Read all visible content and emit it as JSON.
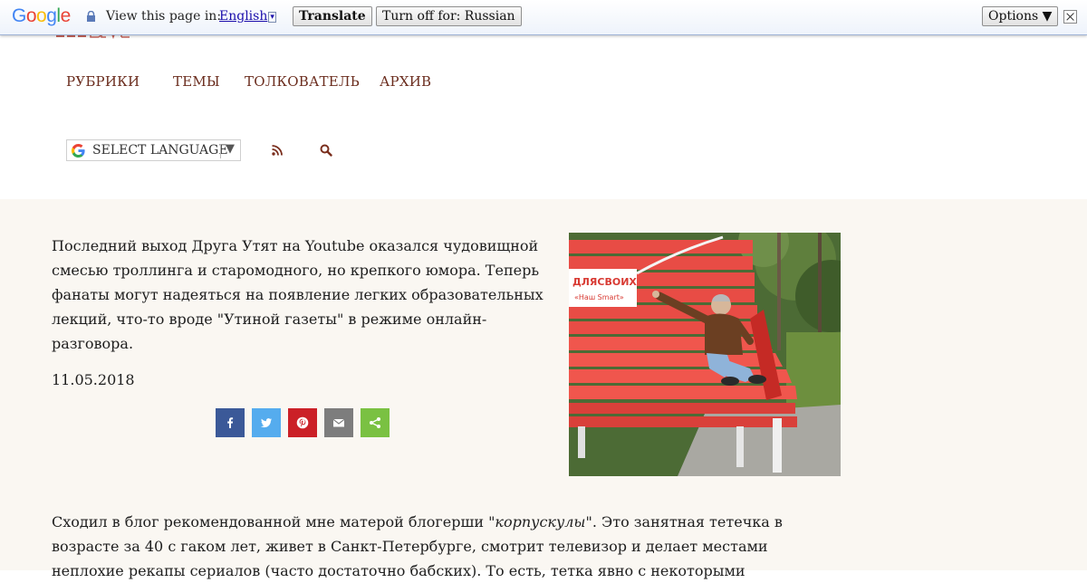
{
  "translate_bar": {
    "logo_text": "Google",
    "view_text": "View this page in:",
    "language": "English",
    "language_arrow": "▾",
    "translate_button": "Translate",
    "turn_off_button": "Turn off for: Russian",
    "options_button": "Options ▼"
  },
  "header": {
    "nav": [
      "РУБРИКИ",
      "ТЕМЫ",
      "ТОЛКОВАТЕЛЬ",
      "АРХИВ"
    ],
    "language_select": {
      "label": "SELECT LANGUAGE",
      "arrow": "▼"
    },
    "icons": [
      "rss-icon",
      "search-icon"
    ]
  },
  "article_intro": {
    "text": "Последний выход Друга Утят на Youtube оказался чудовищной смесью троллинга и старомодного, но крепкого юмора. Теперь фанаты могут надеяться на появление легких образовательных лекций, что-то вроде \"Утиной газеты\" в режиме онлайн-разговора.",
    "date": "11.05.2018",
    "share_icons": [
      "facebook-icon",
      "twitter-icon",
      "pinterest-icon",
      "email-icon",
      "share-icon"
    ],
    "photo_sign_text": [
      "ДЛЯСВОИХ",
      "«Наш Smart»"
    ]
  },
  "article_body": {
    "before_link": "Сходил в блог рекомендованной мне матерой блогерши \"",
    "link": "корпускулы",
    "after_link": "\". Это занятная тетечка в возрасте за 40 с гаком лет, живет в Санкт-Петербурге, смотрит телевизор и делает местами неплохие рекапы сериалов (часто достаточно бабских). То есть, тетка явно с некоторыми"
  },
  "colors": {
    "nav_text": "#6b2d1e",
    "content_bg": "#faf7f2",
    "facebook": "#3b5998",
    "twitter": "#55acee",
    "pinterest": "#cb2027",
    "email": "#7d7d7d",
    "share": "#7ac142"
  }
}
